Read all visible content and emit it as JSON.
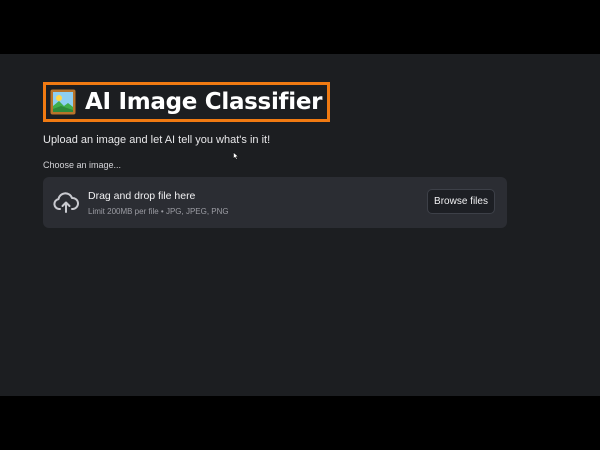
{
  "app": {
    "title_icon": "framed-picture-icon",
    "title": "AI Image Classifier",
    "highlight_color": "#f07a12",
    "subtitle": "Upload an image and let AI tell you what's in it!"
  },
  "uploader": {
    "label": "Choose an image...",
    "icon": "cloud-upload-icon",
    "drop_text": "Drag and drop file here",
    "limit_text": "Limit 200MB per file • JPG, JPEG, PNG",
    "browse_label": "Browse files"
  },
  "colors": {
    "background": "#1c1e21",
    "dropzone": "#2b2d33",
    "letterbox": "#000000"
  }
}
